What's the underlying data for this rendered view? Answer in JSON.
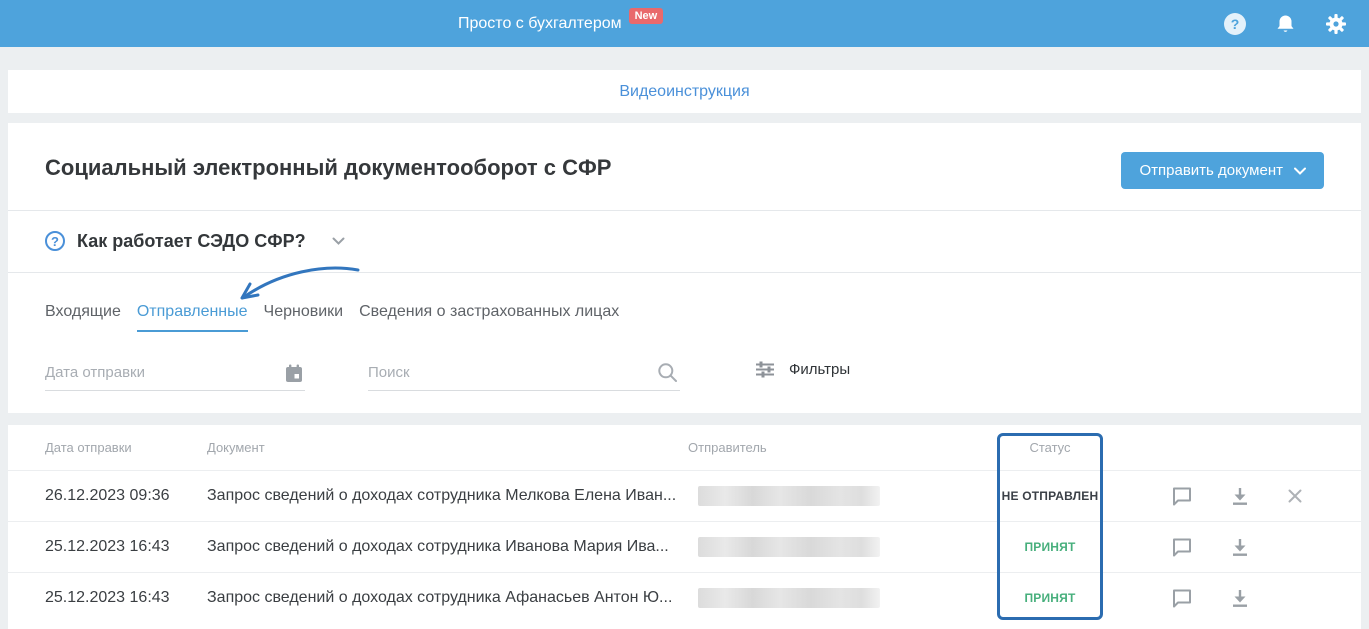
{
  "topbar": {
    "title": "Просто с бухгалтером",
    "badge": "New"
  },
  "toolbar_links": {
    "video_instruction": "Видеоинструкция"
  },
  "page": {
    "title": "Социальный электронный документооборот с СФР",
    "send_document_button": "Отправить документ",
    "how_it_works_label": "Как работает СЭДО СФР?"
  },
  "tabs": [
    {
      "label": "Входящие",
      "active": false
    },
    {
      "label": "Отправленные",
      "active": true
    },
    {
      "label": "Черновики",
      "active": false
    },
    {
      "label": "Сведения о застрахованных лицах",
      "active": false
    }
  ],
  "filters": {
    "date_placeholder": "Дата отправки",
    "date_value": "",
    "search_placeholder": "Поиск",
    "search_value": "",
    "filters_label": "Фильтры"
  },
  "table": {
    "columns": [
      "Дата отправки",
      "Документ",
      "Отправитель",
      "Статус"
    ],
    "rows": [
      {
        "date": "26.12.2023 09:36",
        "document": "Запрос сведений о доходах сотрудника Мелкова Елена Иван...",
        "sender_redacted": true,
        "status": "НЕ ОТПРАВЛЕН",
        "status_color": "#3B4047",
        "can_delete": true
      },
      {
        "date": "25.12.2023 16:43",
        "document": "Запрос сведений о доходах сотрудника Иванова Мария Ива...",
        "sender_redacted": true,
        "status": "ПРИНЯТ",
        "status_color": "#47AF7C",
        "can_delete": false
      },
      {
        "date": "25.12.2023 16:43",
        "document": "Запрос сведений о доходах сотрудника Афанасьев Антон Ю...",
        "sender_redacted": true,
        "status": "ПРИНЯТ",
        "status_color": "#47AF7C",
        "can_delete": false
      }
    ]
  },
  "icons": {
    "topbar": [
      "help-icon",
      "bell-icon",
      "gear-icon"
    ],
    "filters": [
      "calendar-icon",
      "search-icon",
      "tune-icon"
    ],
    "row_actions": [
      "comment-icon",
      "download-icon",
      "delete-icon"
    ],
    "annotations": [
      "curved-arrow-to-sent-tab",
      "status-column-highlight-box"
    ]
  },
  "colors": {
    "topbar": "#4EA3DC",
    "accent_blue": "#4A9BD5",
    "link_blue": "#4A90D9",
    "badge_red": "#E9696C",
    "status_green": "#47AF7C",
    "status_dark": "#3B4047",
    "highlight_border": "#2B6CB0",
    "arrow_blue": "#3276BE",
    "page_bg": "#ECEFF1"
  }
}
